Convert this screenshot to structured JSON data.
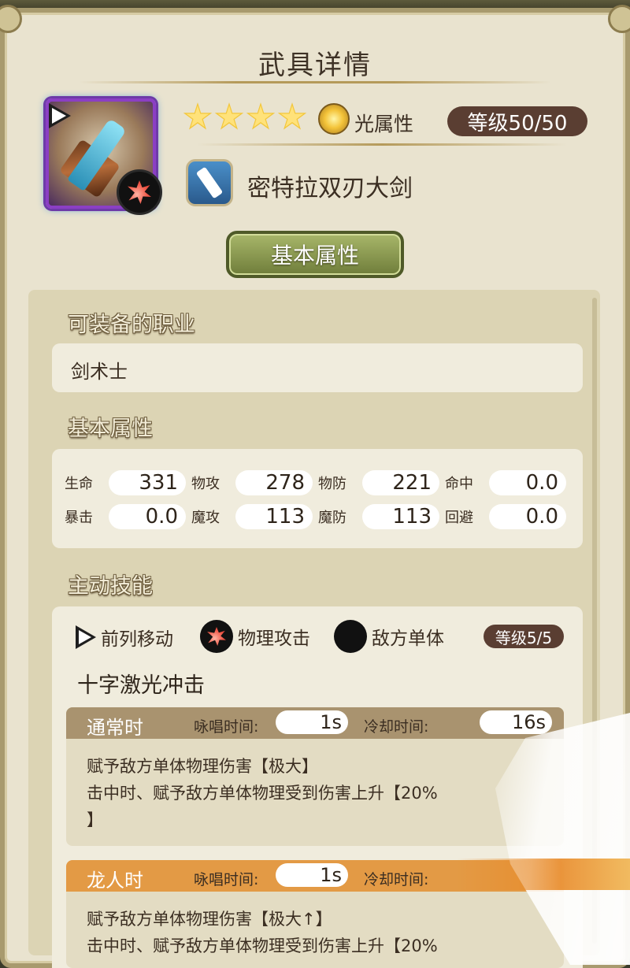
{
  "window": {
    "title": "武具详情"
  },
  "weapon": {
    "stars": 4,
    "attribute_label": "光属性",
    "level_label": "等级50/50",
    "name": "密特拉双刃大剑",
    "icon": "sword-icon",
    "frame_color": "#8b3fc4"
  },
  "tab_button": {
    "label": "基本属性"
  },
  "sections": {
    "jobs_title": "可装备的职业",
    "job": "剑术士",
    "stats_title": "基本属性",
    "skill_title": "主动技能"
  },
  "stats": {
    "hp": {
      "label": "生命",
      "value": "331"
    },
    "patk": {
      "label": "物攻",
      "value": "278"
    },
    "pdef": {
      "label": "物防",
      "value": "221"
    },
    "hit": {
      "label": "命中",
      "value": "0.0"
    },
    "crit": {
      "label": "暴击",
      "value": "0.0"
    },
    "matk": {
      "label": "魔攻",
      "value": "113"
    },
    "mdef": {
      "label": "魔防",
      "value": "113"
    },
    "eva": {
      "label": "回避",
      "value": "0.0"
    }
  },
  "skill": {
    "move": "前列移动",
    "type": "物理攻击",
    "target": "敌方单体",
    "level_label": "等级5/5",
    "name": "十字激光冲击",
    "normal": {
      "label": "通常时",
      "cast_label": "咏唱时间:",
      "cast_value": "1s",
      "cd_label": "冷却时间:",
      "cd_value": "16s",
      "line1": "赋予敌方单体物理伤害【极大】",
      "line2": "击中时、赋予敌方单体物理受到伤害上升【20%",
      "line3": "】"
    },
    "dragon": {
      "label": "龙人时",
      "cast_label": "咏唱时间:",
      "cast_value": "1s",
      "cd_label": "冷却时间:",
      "line1": "赋予敌方单体物理伤害【极大↑】",
      "line2": "击中时、赋予敌方单体物理受到伤害上升【20%"
    }
  },
  "colors": {
    "normal_header": "#a9936f",
    "dragon_header": "#e39a45",
    "pill": "#5a3e32"
  }
}
